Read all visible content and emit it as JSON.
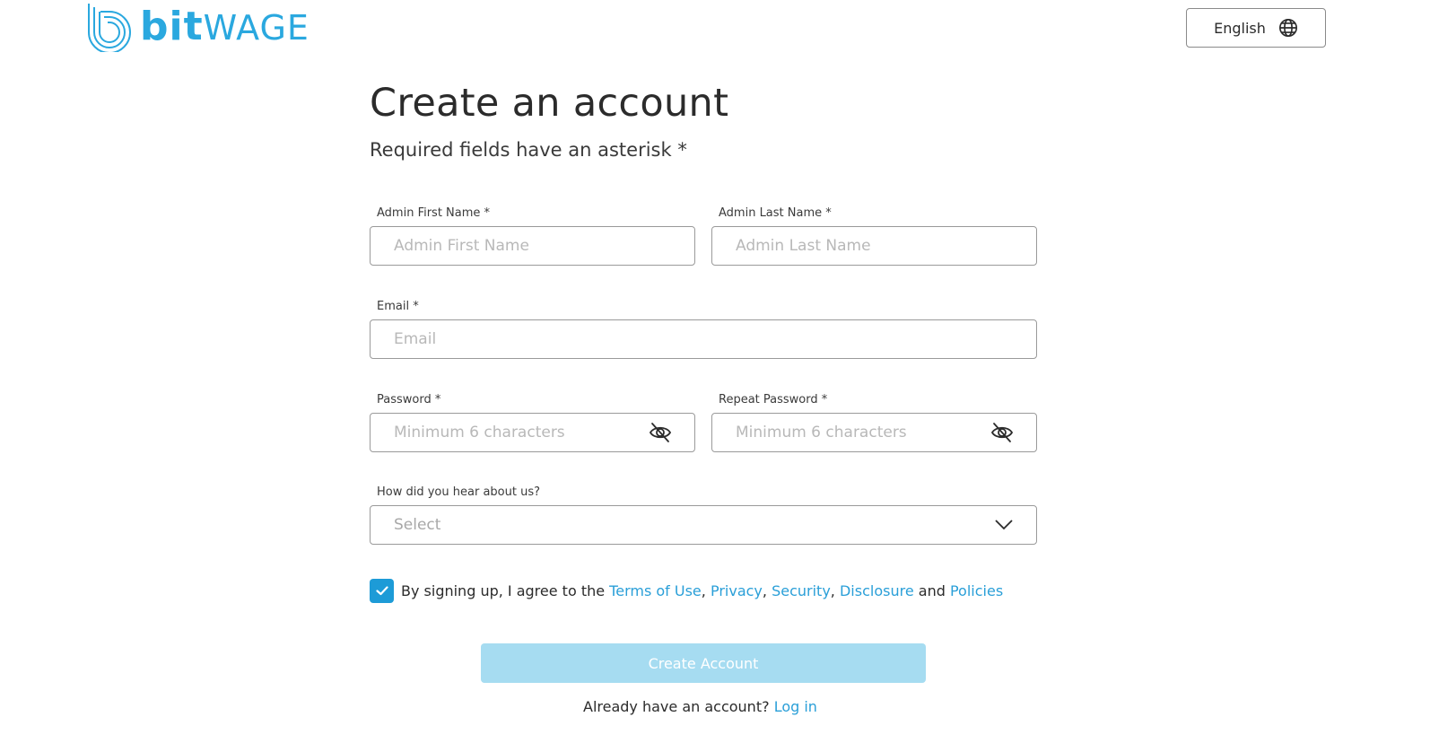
{
  "brand": {
    "logo_bit": "bit",
    "logo_wage": "WAGE",
    "color": "#2aa8df",
    "icon": "bitwage-logo-icon"
  },
  "language": {
    "label": "English",
    "icon": "globe-icon"
  },
  "page": {
    "title": "Create an account",
    "subtitle": "Required fields have an asterisk *"
  },
  "form": {
    "first_name": {
      "label": "Admin First Name *",
      "placeholder": "Admin First Name",
      "value": ""
    },
    "last_name": {
      "label": "Admin Last Name *",
      "placeholder": "Admin Last Name",
      "value": ""
    },
    "email": {
      "label": "Email *",
      "placeholder": "Email",
      "value": ""
    },
    "password": {
      "label": "Password *",
      "placeholder": "Minimum 6 characters",
      "value": "",
      "toggle_icon": "eye-off-icon"
    },
    "repeat_password": {
      "label": "Repeat Password *",
      "placeholder": "Minimum 6 characters",
      "value": "",
      "toggle_icon": "eye-off-icon"
    },
    "referral": {
      "label": "How did you hear about us?",
      "selected": "Select",
      "icon": "chevron-down-icon"
    }
  },
  "agreement": {
    "checked": true,
    "prefix": "By signing up, I agree to the",
    "terms": "Terms of Use",
    "sep1": ",",
    "privacy": "Privacy",
    "sep2": ",",
    "security": "Security",
    "sep3": ",",
    "disclosure": "Disclosure",
    "and": "and",
    "policies": "Policies"
  },
  "submit": {
    "label": "Create Account"
  },
  "login": {
    "prompt": "Already have an account?",
    "link": "Log in"
  },
  "colors": {
    "accent": "#2a9fd8",
    "button_disabled": "#a6dcf1",
    "checkbox": "#1d9bd7"
  }
}
